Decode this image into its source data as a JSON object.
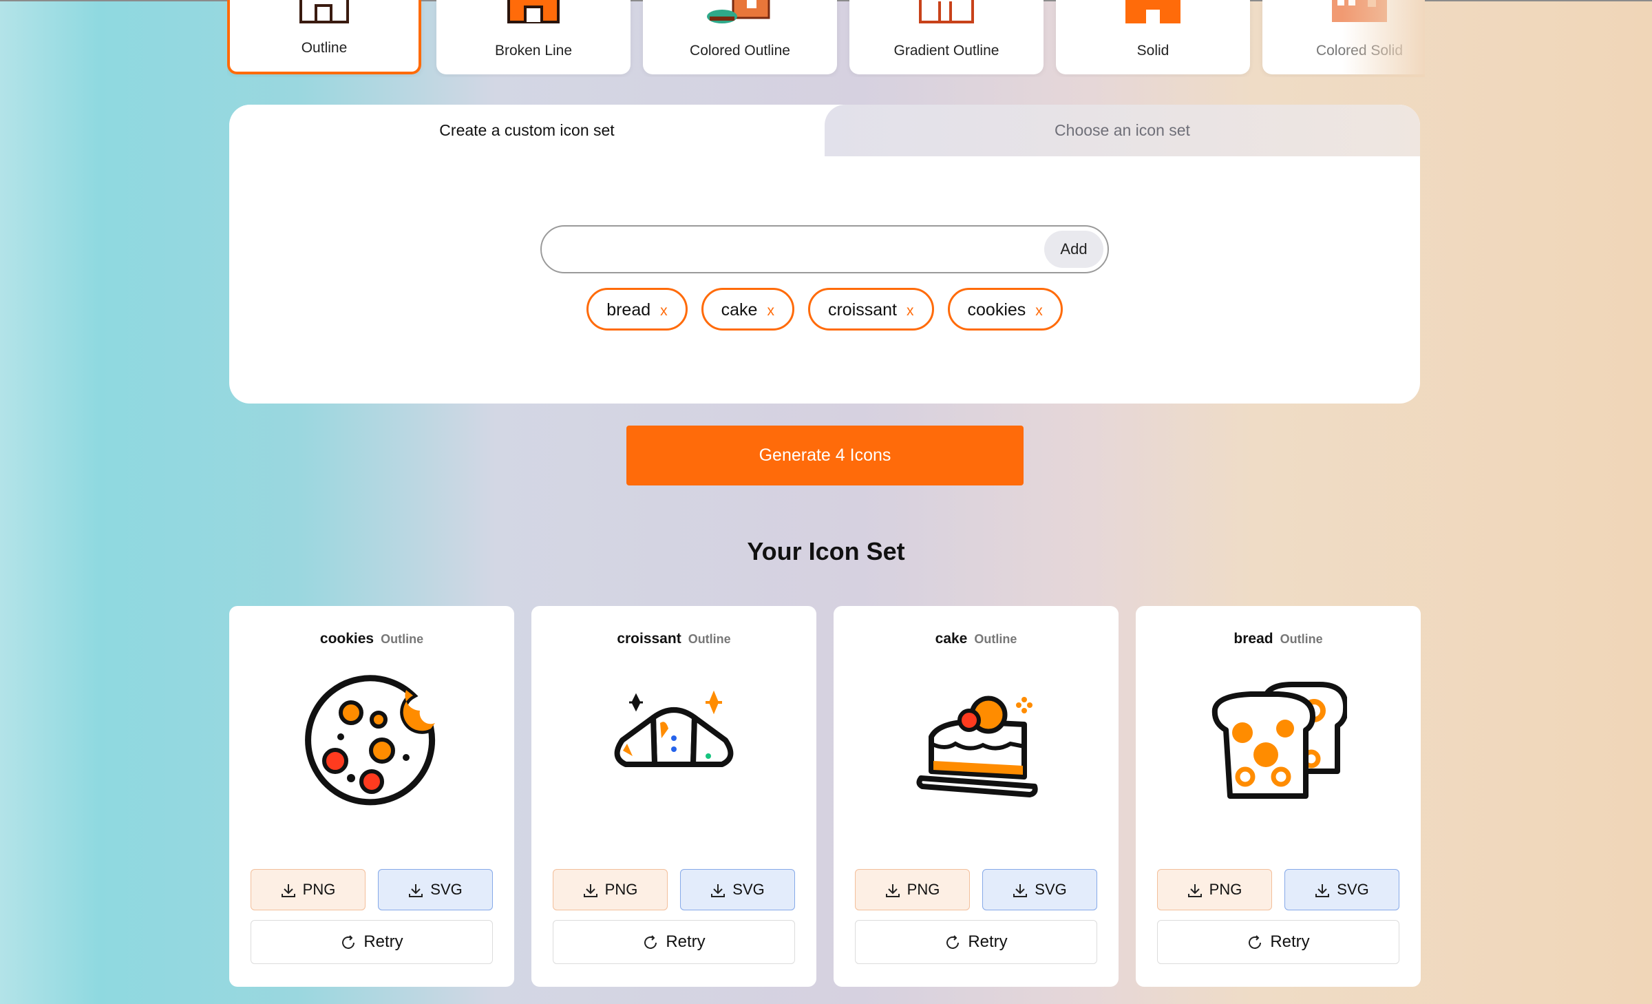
{
  "style_tabs": [
    {
      "label": "Outline",
      "active": true
    },
    {
      "label": "Broken Line",
      "active": false
    },
    {
      "label": "Colored Outline",
      "active": false
    },
    {
      "label": "Gradient Outline",
      "active": false
    },
    {
      "label": "Solid",
      "active": false
    },
    {
      "label": "Colored Solid",
      "active": false
    }
  ],
  "next_arrow": "›",
  "panel": {
    "tabs": [
      {
        "label": "Create a custom icon set",
        "active": true
      },
      {
        "label": "Choose an icon set",
        "active": false
      }
    ],
    "input_value": "",
    "add_label": "Add",
    "tags": [
      {
        "label": "bread",
        "remove": "x"
      },
      {
        "label": "cake",
        "remove": "x"
      },
      {
        "label": "croissant",
        "remove": "x"
      },
      {
        "label": "cookies",
        "remove": "x"
      }
    ]
  },
  "generate_label": "Generate 4 Icons",
  "section_title": "Your Icon Set",
  "icon_cards": [
    {
      "name": "cookies",
      "style": "Outline",
      "icon": "cookie-icon",
      "png": "PNG",
      "svg": "SVG",
      "retry": "Retry"
    },
    {
      "name": "croissant",
      "style": "Outline",
      "icon": "croissant-icon",
      "png": "PNG",
      "svg": "SVG",
      "retry": "Retry"
    },
    {
      "name": "cake",
      "style": "Outline",
      "icon": "cake-icon",
      "png": "PNG",
      "svg": "SVG",
      "retry": "Retry"
    },
    {
      "name": "bread",
      "style": "Outline",
      "icon": "bread-icon",
      "png": "PNG",
      "svg": "SVG",
      "retry": "Retry"
    }
  ],
  "colors": {
    "accent": "#ff6b0a",
    "png_bg": "#fdefe4",
    "svg_bg": "#e3ecfb"
  }
}
